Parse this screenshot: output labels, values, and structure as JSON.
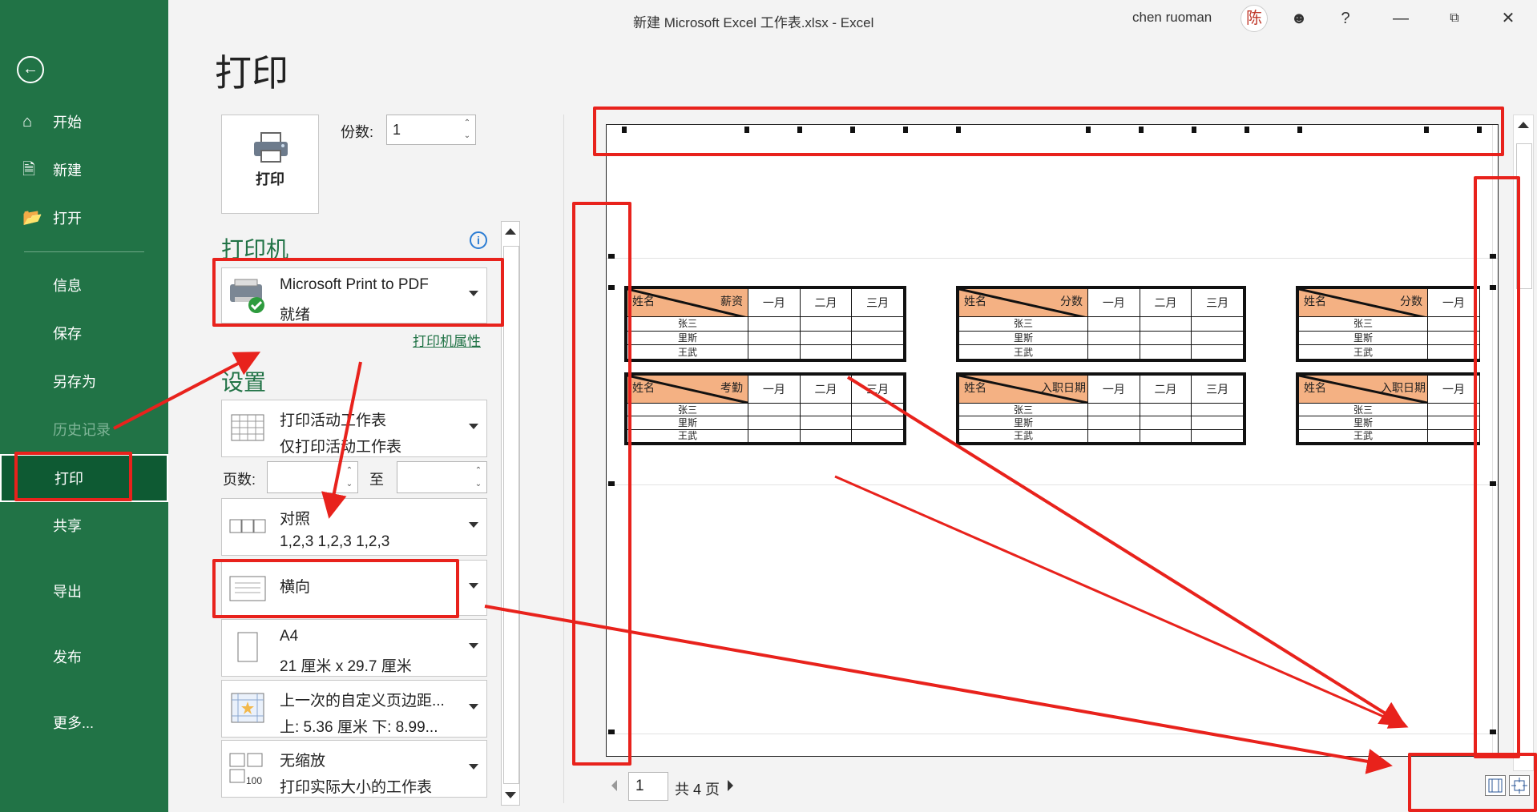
{
  "window": {
    "title": "新建 Microsoft Excel 工作表.xlsx  -  Excel",
    "user": "chen ruoman",
    "avatar_char": "陈",
    "help": "?",
    "buttons": [
      "minimize",
      "restore",
      "close"
    ]
  },
  "nav": {
    "items": [
      {
        "label": "开始",
        "icon": "home-icon"
      },
      {
        "label": "新建",
        "icon": "new-file-icon"
      },
      {
        "label": "打开",
        "icon": "folder-open-icon"
      },
      {
        "label": "信息"
      },
      {
        "label": "保存"
      },
      {
        "label": "另存为"
      },
      {
        "label": "历史记录",
        "disabled": true
      },
      {
        "label": "打印",
        "active": true
      },
      {
        "label": "共享"
      },
      {
        "label": "导出"
      },
      {
        "label": "发布"
      },
      {
        "label": "更多..."
      }
    ]
  },
  "print": {
    "heading": "打印",
    "button_label": "打印",
    "copies_label": "份数:",
    "copies_value": "1",
    "printer_section": "打印机",
    "printer_name": "Microsoft Print to PDF",
    "printer_status": "就绪",
    "printer_properties": "打印机属性",
    "settings_section": "设置",
    "what_line1": "打印活动工作表",
    "what_line2": "仅打印活动工作表",
    "pages_label": "页数:",
    "pages_to": "至",
    "collate_line1": "对照",
    "collate_line2": "1,2,3    1,2,3    1,2,3",
    "orientation": "横向",
    "paper_line1": "A4",
    "paper_line2": "21 厘米 x 29.7 厘米",
    "margins_line1": "上一次的自定义页边距...",
    "margins_line2": "上: 5.36 厘米 下: 8.99...",
    "scaling_line1": "无缩放",
    "scaling_line2": "打印实际大小的工作表",
    "scaling_badge": "100"
  },
  "preview": {
    "current_page": "1",
    "total_pages": "共 4 页",
    "tables": [
      {
        "left_header": "姓名",
        "right_header": "薪资",
        "months": [
          "一月",
          "二月",
          "三月"
        ],
        "rows": [
          "张三",
          "里斯",
          "王武"
        ]
      },
      {
        "left_header": "姓名",
        "right_header": "分数",
        "months": [
          "一月",
          "二月",
          "三月"
        ],
        "rows": [
          "张三",
          "里斯",
          "王武"
        ]
      },
      {
        "left_header": "姓名",
        "right_header": "分数",
        "months": [
          "一月"
        ],
        "rows": [
          "张三",
          "里斯",
          "王武"
        ]
      },
      {
        "left_header": "姓名",
        "right_header": "考勤",
        "months": [
          "一月",
          "二月",
          "三月"
        ],
        "rows": [
          "张三",
          "里斯",
          "王武"
        ]
      },
      {
        "left_header": "姓名",
        "right_header": "入职日期",
        "months": [
          "一月",
          "二月",
          "三月"
        ],
        "rows": [
          "张三",
          "里斯",
          "王武"
        ]
      },
      {
        "left_header": "姓名",
        "right_header": "入职日期",
        "months": [
          "一月"
        ],
        "rows": [
          "张三",
          "里斯",
          "王武"
        ]
      }
    ]
  },
  "colors": {
    "nav_bg": "#217346",
    "accent": "#217346",
    "header_fill": "#f4b183",
    "annotation": "#e8221c"
  }
}
